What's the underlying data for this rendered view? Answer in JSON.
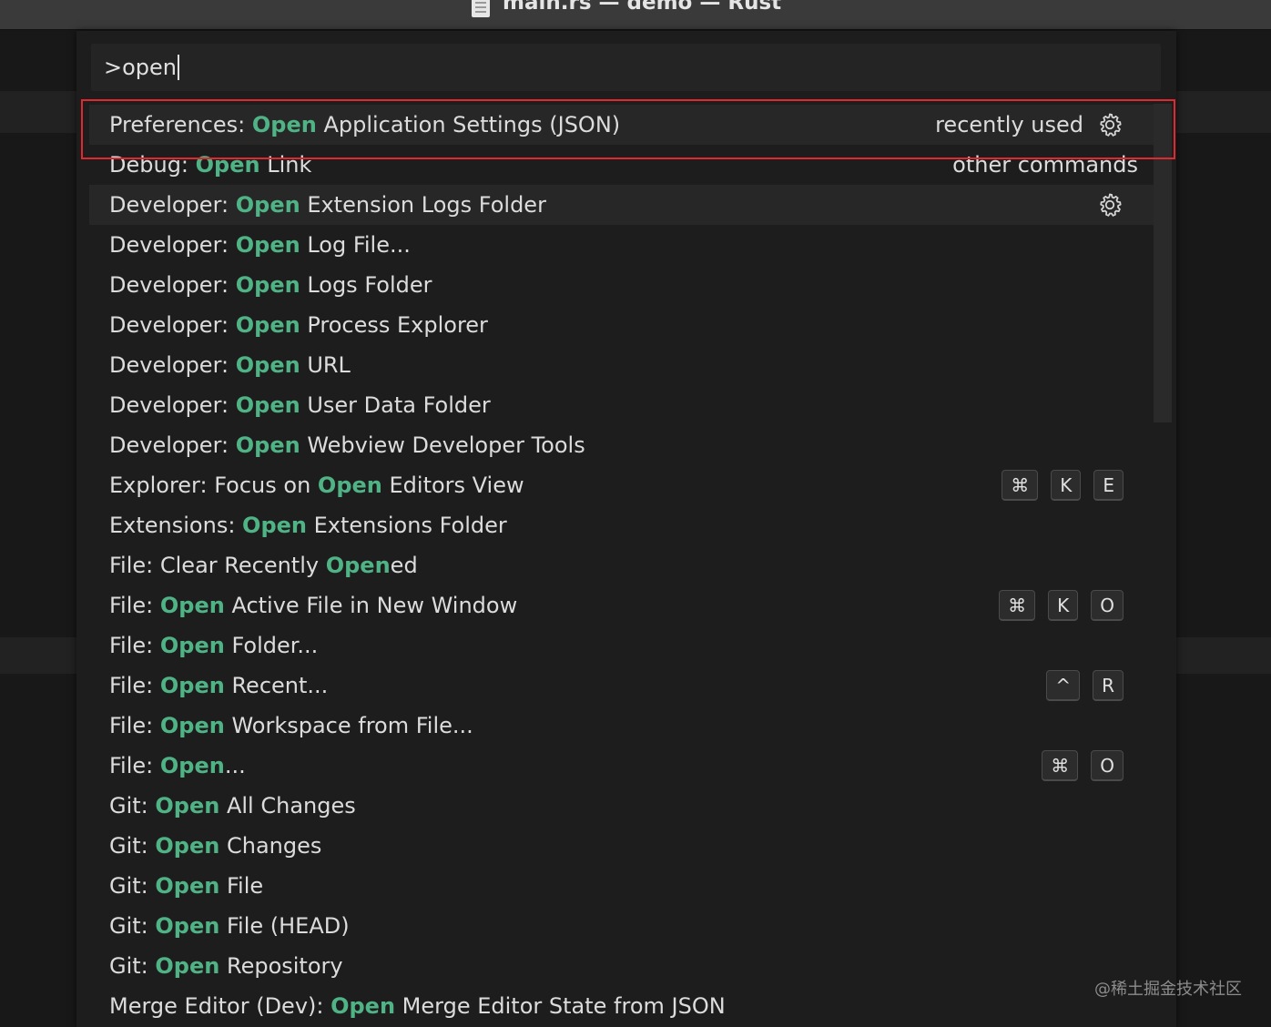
{
  "window": {
    "title": "main.rs — demo — Rust"
  },
  "palette": {
    "input_value": ">open",
    "items": [
      {
        "prefix": "Preferences: ",
        "match": "Open",
        "suffix": " Application Settings (JSON)",
        "meta": "recently used",
        "gear": true
      },
      {
        "prefix": "Debug: ",
        "match": "Open",
        "suffix": " Link",
        "meta": "other commands"
      },
      {
        "prefix": "Developer: ",
        "match": "Open",
        "suffix": " Extension Logs Folder",
        "gear": true
      },
      {
        "prefix": "Developer: ",
        "match": "Open",
        "suffix": " Log File..."
      },
      {
        "prefix": "Developer: ",
        "match": "Open",
        "suffix": " Logs Folder"
      },
      {
        "prefix": "Developer: ",
        "match": "Open",
        "suffix": " Process Explorer"
      },
      {
        "prefix": "Developer: ",
        "match": "Open",
        "suffix": " URL"
      },
      {
        "prefix": "Developer: ",
        "match": "Open",
        "suffix": " User Data Folder"
      },
      {
        "prefix": "Developer: ",
        "match": "Open",
        "suffix": " Webview Developer Tools"
      },
      {
        "prefix": "Explorer: Focus on ",
        "match": "Open",
        "suffix": " Editors View",
        "keys": [
          "⌘",
          "K",
          "E"
        ]
      },
      {
        "prefix": "Extensions: ",
        "match": "Open",
        "suffix": " Extensions Folder"
      },
      {
        "prefix": "File: Clear Recently ",
        "match": "Open",
        "suffix": "ed"
      },
      {
        "prefix": "File: ",
        "match": "Open",
        "suffix": " Active File in New Window",
        "keys": [
          "⌘",
          "K",
          "O"
        ]
      },
      {
        "prefix": "File: ",
        "match": "Open",
        "suffix": " Folder..."
      },
      {
        "prefix": "File: ",
        "match": "Open",
        "suffix": " Recent...",
        "keys": [
          "^",
          "R"
        ]
      },
      {
        "prefix": "File: ",
        "match": "Open",
        "suffix": " Workspace from File..."
      },
      {
        "prefix": "File: ",
        "match": "Open",
        "suffix": "...",
        "keys": [
          "⌘",
          "O"
        ]
      },
      {
        "prefix": "Git: ",
        "match": "Open",
        "suffix": " All Changes"
      },
      {
        "prefix": "Git: ",
        "match": "Open",
        "suffix": " Changes"
      },
      {
        "prefix": "Git: ",
        "match": "Open",
        "suffix": " File"
      },
      {
        "prefix": "Git: ",
        "match": "Open",
        "suffix": " File (HEAD)"
      },
      {
        "prefix": "Git: ",
        "match": "Open",
        "suffix": " Repository"
      },
      {
        "prefix": "Merge Editor (Dev): ",
        "match": "Open",
        "suffix": " Merge Editor State from JSON"
      }
    ]
  },
  "watermark": "@稀土掘金技术社区",
  "colors": {
    "match_highlight": "#4fb386",
    "annotation_border": "#e0282e",
    "palette_bg": "#1d1d1d"
  }
}
